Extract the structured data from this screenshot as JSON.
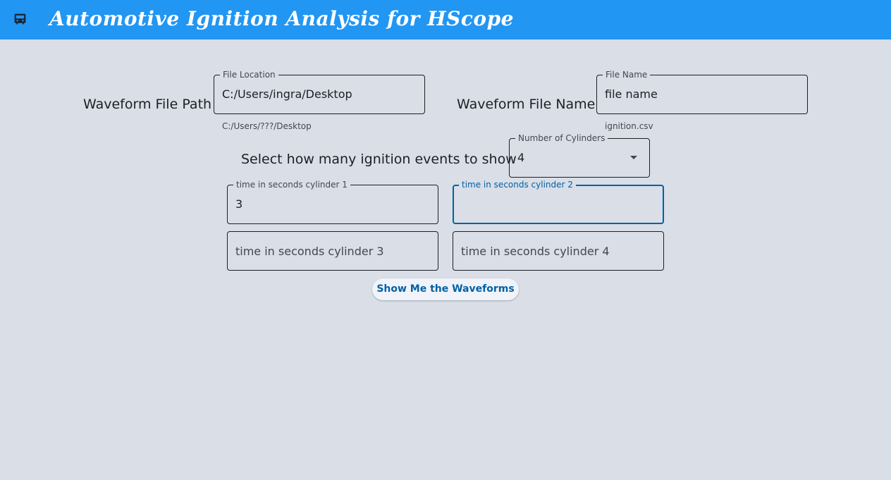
{
  "app": {
    "title": "Automotive Ignition Analysis for HScope",
    "icon": "car-icon",
    "accent": "#2196f3",
    "background": "#d9dee7"
  },
  "file_path": {
    "row_label": "Waveform File Path",
    "field_label": "File Location",
    "value": "C:/Users/ingra/Desktop",
    "helper": "C:/Users/???/Desktop"
  },
  "file_name": {
    "row_label": "Waveform File Name",
    "field_label": "File Name",
    "value": "file name",
    "helper": "ignition.csv"
  },
  "cylinders": {
    "prompt": "Select how many ignition events to show",
    "field_label": "Number of Cylinders",
    "selected": "4",
    "icon": "arrow-drop-down-icon"
  },
  "times": [
    {
      "label": "time in seconds cylinder 1",
      "value": "3",
      "state": "filled"
    },
    {
      "label": "time in seconds cylinder 2",
      "value": "",
      "state": "focused"
    },
    {
      "label": "time in seconds cylinder 3",
      "value": "",
      "state": "empty"
    },
    {
      "label": "time in seconds cylinder 4",
      "value": "",
      "state": "empty"
    }
  ],
  "action": {
    "label": "Show Me the Waveforms",
    "color": "#0061a4"
  }
}
